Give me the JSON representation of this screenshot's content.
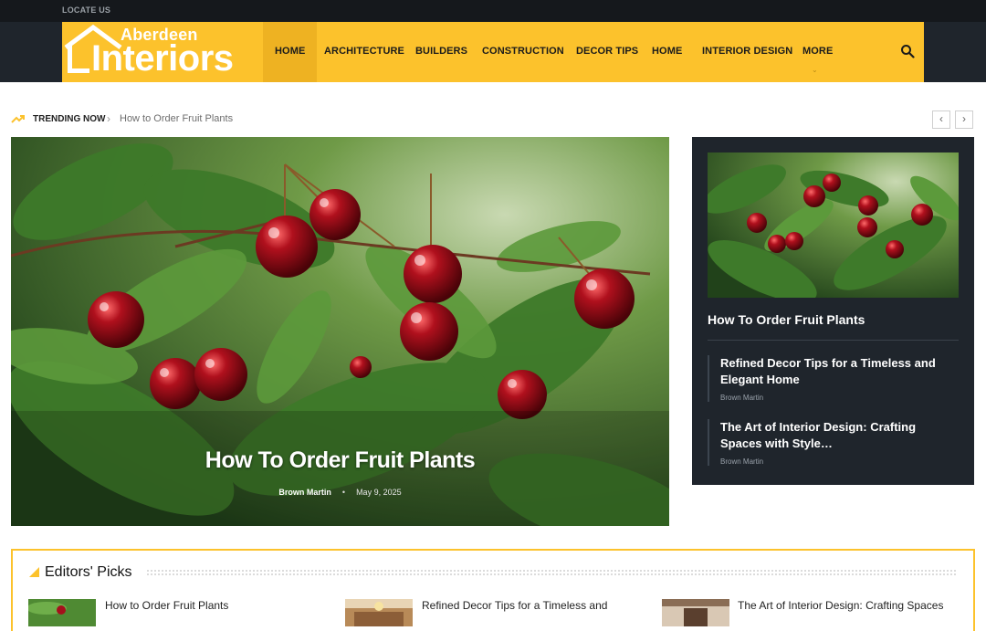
{
  "topbar": {
    "locate_label": "LOCATE US"
  },
  "brand": {
    "name_small": "Aberdeen",
    "name_big": "Interiors"
  },
  "nav": {
    "items": [
      {
        "label": "HOME",
        "active": true
      },
      {
        "label": "ARCHITECTURE"
      },
      {
        "label": "BUILDERS"
      },
      {
        "label": "CONSTRUCTION"
      },
      {
        "label": "DECOR TIPS"
      },
      {
        "label": "HOME"
      },
      {
        "label": "INTERIOR DESIGN"
      },
      {
        "label": "MORE"
      }
    ],
    "search_icon": "search-icon",
    "more_icon": "chevron-down-icon"
  },
  "trending": {
    "label": "TRENDING NOW",
    "separator": "›",
    "link": "How to Order Fruit Plants",
    "prev": "‹",
    "next": "›"
  },
  "hero": {
    "title": "How To Order Fruit Plants",
    "author": "Brown Martin",
    "date": "May 9, 2025"
  },
  "side": {
    "main_title": "How To Order Fruit Plants",
    "items": [
      {
        "title": "Refined Decor Tips for a Timeless and Elegant Home",
        "author": "Brown Martin"
      },
      {
        "title": "The Art of Interior Design: Crafting Spaces with Style…",
        "author": "Brown Martin"
      }
    ]
  },
  "editors_picks": {
    "title": "Editors' Picks",
    "items": [
      {
        "title": "How to Order Fruit Plants"
      },
      {
        "title": "Refined Decor Tips for a Timeless and"
      },
      {
        "title": "The Art of Interior Design: Crafting Spaces"
      }
    ]
  },
  "colors": {
    "accent": "#fcc22c",
    "dark": "#1f252c",
    "topbar": "#15181c"
  }
}
